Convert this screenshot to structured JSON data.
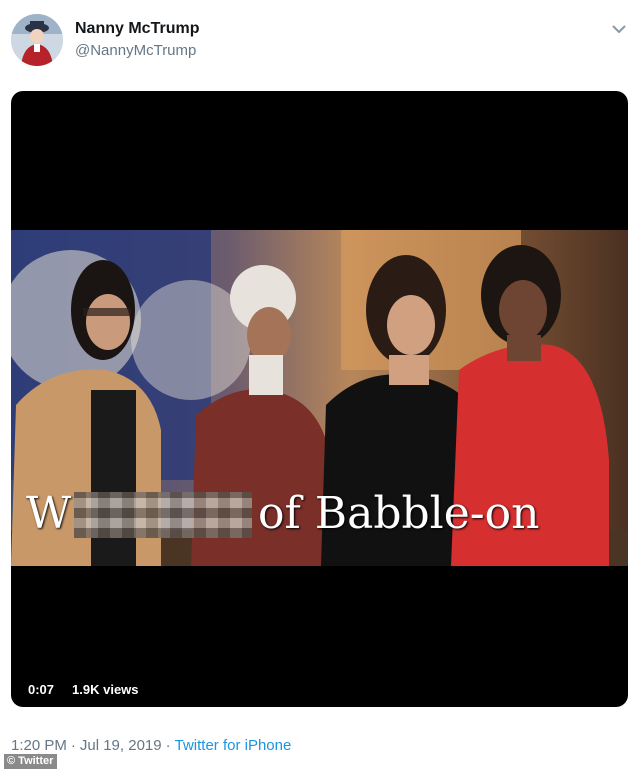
{
  "tweet": {
    "display_name": "Nanny McTrump",
    "handle": "@NannyMcTrump",
    "avatar_icon": "avatar-image",
    "menu_icon": "chevron-down-icon"
  },
  "video": {
    "caption_first_letter": "W",
    "caption_rest": "of Babble-on",
    "duration": "0:07",
    "views": "1.9K views"
  },
  "footer": {
    "time": "1:20 PM",
    "separator": "·",
    "date": "Jul 19, 2019",
    "source": "Twitter for iPhone"
  },
  "credit": "© Twitter",
  "colors": {
    "link": "#1b95e0",
    "secondary_text": "#657786",
    "media_background": "#000000"
  }
}
